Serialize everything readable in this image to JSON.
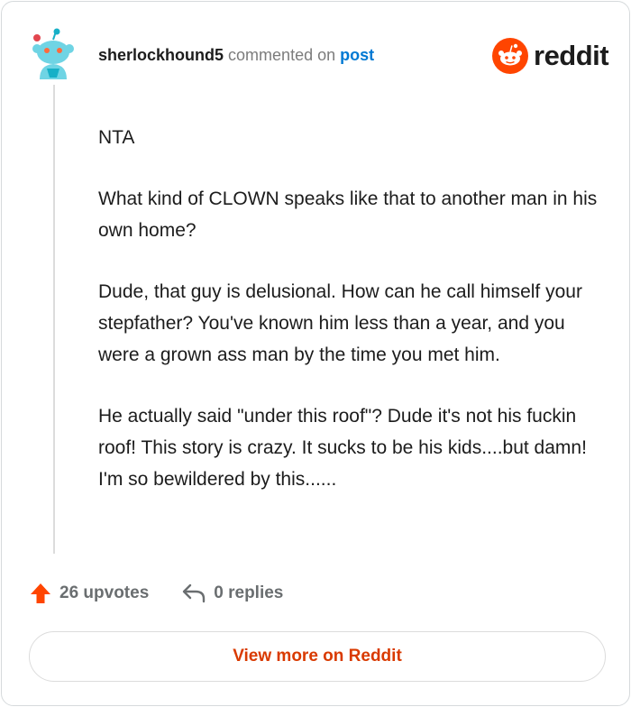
{
  "comment": {
    "username": "sherlockhound5",
    "action_text": "commented on",
    "post_link": "post",
    "paragraphs": [
      "NTA",
      "What kind of CLOWN speaks like that to another man in his own home?",
      "Dude, that guy is delusional. How can he call himself your stepfather? You've known him less than a year, and you were a grown ass man by the time you met him.",
      "He actually said \"under this roof\"? Dude it's not his fuckin roof! This story is crazy. It sucks to be his kids....but damn! I'm so bewildered by this......"
    ]
  },
  "brand": {
    "wordmark": "reddit",
    "accent": "#ff4500"
  },
  "actions": {
    "upvotes": "26 upvotes",
    "replies": "0 replies"
  },
  "footer": {
    "view_more_label": "View more on Reddit"
  },
  "icons": {
    "avatar": "snoo-avatar-icon",
    "logo": "reddit-logo-icon",
    "upvote": "upvote-arrow-icon",
    "reply": "reply-arrow-icon"
  }
}
